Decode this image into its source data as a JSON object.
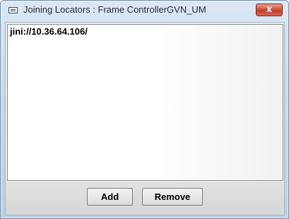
{
  "window": {
    "title": "Joining Locators : Frame ControllerGVN_UM",
    "close_glyph": "x",
    "icon": "window-app-icon"
  },
  "list": {
    "items": [
      {
        "label": "jini://10.36.64.106/"
      }
    ]
  },
  "buttons": {
    "add_label": "Add",
    "remove_label": "Remove"
  },
  "colors": {
    "close_button": "#c0392b",
    "title_bar": "#c9d9ec"
  }
}
